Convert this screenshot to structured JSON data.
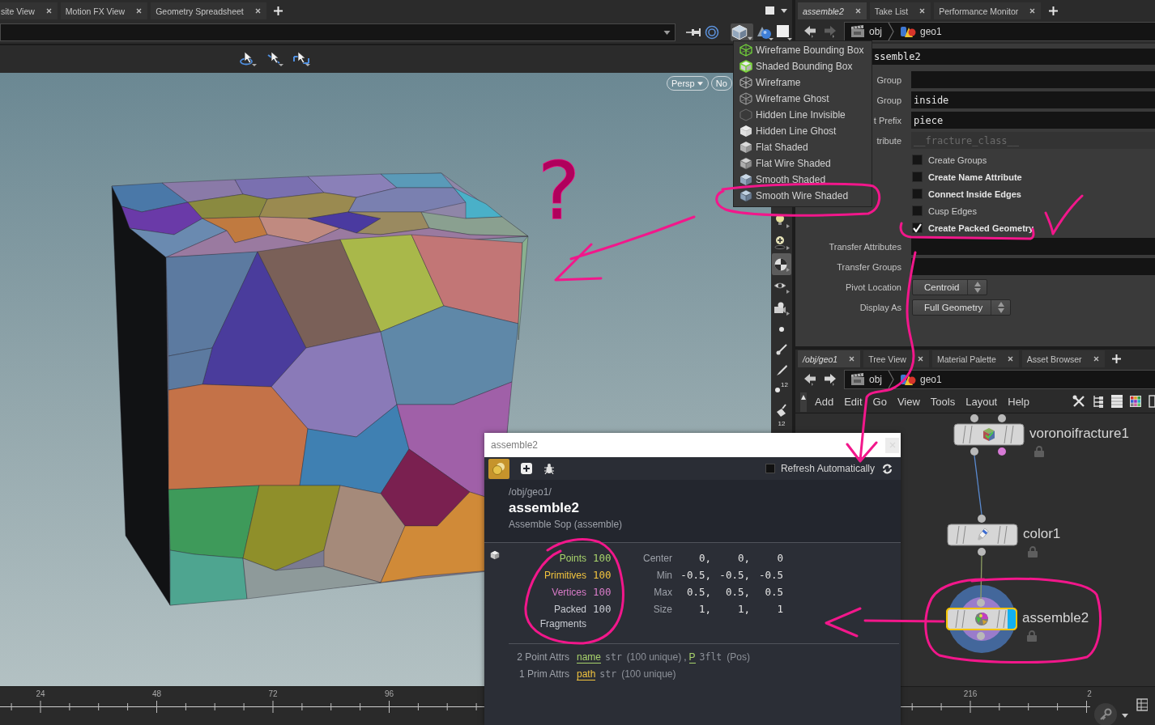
{
  "viewer": {
    "tabs": [
      {
        "label": "site View",
        "selected": false
      },
      {
        "label": "Motion FX View",
        "selected": false
      },
      {
        "label": "Geometry Spreadsheet",
        "selected": false
      }
    ],
    "view_menus": [
      {
        "label": "Persp",
        "caret": true
      },
      {
        "label": "No",
        "caret": false
      }
    ],
    "display_menu": [
      {
        "label": "Wireframe Bounding Box",
        "kind": "wirebox"
      },
      {
        "label": "Shaded Bounding Box",
        "kind": "shadedbox"
      },
      {
        "label": "Wireframe",
        "kind": "wire"
      },
      {
        "label": "Wireframe Ghost",
        "kind": "ghost"
      },
      {
        "label": "Hidden Line Invisible",
        "kind": "hidden"
      },
      {
        "label": "Hidden Line Ghost",
        "kind": "hiddenghost"
      },
      {
        "label": "Flat Shaded",
        "kind": "flat"
      },
      {
        "label": "Flat Wire Shaded",
        "kind": "flatwire"
      },
      {
        "label": "Smooth Shaded",
        "kind": "smooth"
      },
      {
        "label": "Smooth Wire Shaded",
        "kind": "smoothwire"
      }
    ],
    "side_tools": [
      {
        "kind": "bulb",
        "selected": false
      },
      {
        "kind": "bulbplus",
        "selected": false
      },
      {
        "kind": "ball",
        "selected": true
      },
      {
        "kind": "eye",
        "selected": false
      },
      {
        "kind": "camera",
        "selected": false
      },
      {
        "kind": "dot",
        "selected": false
      },
      {
        "kind": "dropper",
        "selected": false
      },
      {
        "kind": "pen",
        "selected": false
      },
      {
        "kind": "dot",
        "selected": false,
        "badge": "12"
      },
      {
        "kind": "bucket",
        "selected": false
      },
      {
        "kind": "none",
        "selected": false,
        "badge": "12"
      }
    ],
    "annotation": "?"
  },
  "parameters": {
    "tabs": [
      {
        "label": "assemble2",
        "selected": true
      },
      {
        "label": "Take List",
        "selected": false
      },
      {
        "label": "Performance Monitor",
        "selected": false
      }
    ],
    "forward_disabled": true,
    "path": [
      {
        "label": "obj",
        "kind": "obj"
      },
      {
        "label": "geo1",
        "kind": "geo"
      }
    ],
    "node_name": "ssemble2",
    "rows": [
      {
        "kind": "field",
        "label": "Group",
        "disabled": false
      },
      {
        "kind": "field",
        "label": "Group",
        "value": "inside",
        "disabled": false
      },
      {
        "kind": "field",
        "label": "t Prefix",
        "value": "piece",
        "disabled": false
      },
      {
        "kind": "field",
        "label": "tribute",
        "value": "__fracture_class__",
        "disabled": true
      },
      {
        "kind": "toggle",
        "label": "Create Groups",
        "checked": false,
        "modified": false
      },
      {
        "kind": "toggle",
        "label": "Create Name Attribute",
        "checked": false,
        "modified": true
      },
      {
        "kind": "toggle",
        "label": "Connect Inside Edges",
        "checked": false,
        "modified": true
      },
      {
        "kind": "toggle",
        "label": "Cusp Edges",
        "checked": false,
        "modified": false
      },
      {
        "kind": "toggle",
        "label": "Create Packed Geometry",
        "checked": true,
        "modified": true
      },
      {
        "kind": "field",
        "label": "Transfer Attributes",
        "disabled": false
      },
      {
        "kind": "field",
        "label": "Transfer Groups",
        "disabled": false
      },
      {
        "kind": "menu",
        "label": "Pivot Location",
        "value": "Centroid"
      },
      {
        "kind": "menu",
        "label": "Display As",
        "value": "Full Geometry"
      }
    ]
  },
  "network": {
    "tabs": [
      {
        "label": "/obj/geo1",
        "selected": true
      },
      {
        "label": "Tree View",
        "selected": false
      },
      {
        "label": "Material Palette",
        "selected": false
      },
      {
        "label": "Asset Browser",
        "selected": false
      }
    ],
    "forward_disabled": false,
    "path": [
      {
        "label": "obj",
        "kind": "obj"
      },
      {
        "label": "geo1",
        "kind": "geo"
      }
    ],
    "menu": [
      "Add",
      "Edit",
      "Go",
      "View",
      "Tools",
      "Layout",
      "Help"
    ],
    "nodes": [
      {
        "name": "voronoifracture1",
        "kind": "fracture",
        "selected": false,
        "display": false
      },
      {
        "name": "color1",
        "kind": "color",
        "selected": false,
        "display": false
      },
      {
        "name": "assemble2",
        "kind": "assemble",
        "selected": true,
        "display": true
      }
    ]
  },
  "info_window": {
    "title": "assemble2",
    "refresh": {
      "label": "Refresh Automatically",
      "checked": false
    },
    "path": "/obj/geo1/",
    "node": "assemble2",
    "type": "Assemble Sop (assemble)",
    "stats": [
      {
        "label": "Points",
        "value": "100",
        "color": "#a9d46c"
      },
      {
        "label": "Primitives",
        "value": "100",
        "color": "#f2c43e"
      },
      {
        "label": "Vertices",
        "value": "100",
        "color": "#d97cc9"
      },
      {
        "label": "Packed Fragments",
        "value": "100",
        "color": "#c9ccd3"
      }
    ],
    "bounds": [
      {
        "label": "Center",
        "values": [
          "0,",
          "0,",
          "0"
        ]
      },
      {
        "label": "Min",
        "values": [
          "-0.5,",
          "-0.5,",
          "-0.5"
        ]
      },
      {
        "label": "Max",
        "values": [
          "0.5,",
          "0.5,",
          "0.5"
        ]
      },
      {
        "label": "Size",
        "values": [
          "1,",
          "1,",
          "1"
        ]
      }
    ],
    "attr_groups": [
      {
        "label": "2 Point Attrs",
        "separator": ",",
        "attrs": [
          {
            "name": "name",
            "type": "str",
            "note": "(100 unique)",
            "color": "#a9d46c"
          },
          {
            "name": "P",
            "type": "3flt",
            "note": "(Pos)",
            "color": "#a9d46c"
          }
        ]
      },
      {
        "label": "1 Prim Attrs",
        "attrs": [
          {
            "name": "path",
            "type": "str",
            "note": "(100 unique)",
            "color": "#f2c43e"
          }
        ]
      }
    ]
  },
  "timeline": {
    "labels": [
      "24",
      "48",
      "72",
      "96",
      "216",
      "2"
    ]
  }
}
